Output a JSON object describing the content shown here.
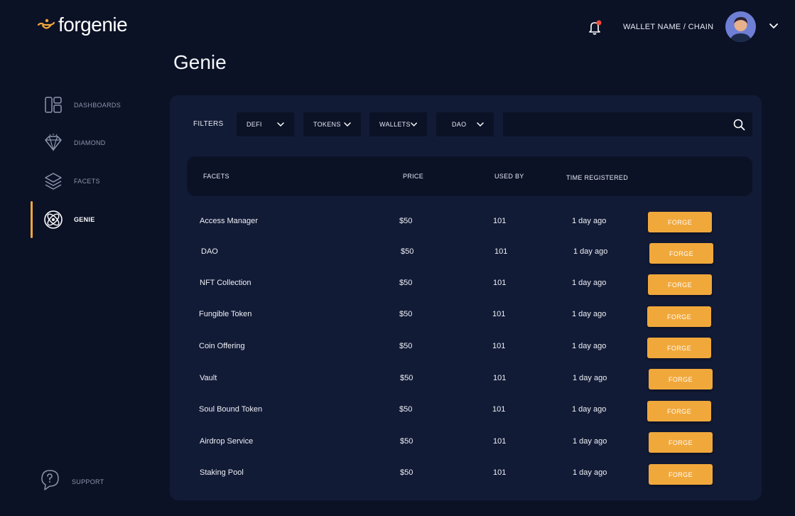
{
  "app": {
    "logo_text": "forgenie"
  },
  "header": {
    "wallet_label": "WALLET NAME / CHAIN"
  },
  "page": {
    "title": "Genie"
  },
  "sidebar": {
    "items": [
      {
        "label": "DASHBOARDS",
        "icon": "dashboard-icon"
      },
      {
        "label": "DIAMOND",
        "icon": "diamond-icon"
      },
      {
        "label": "FACETS",
        "icon": "layers-icon"
      },
      {
        "label": "GENIE",
        "icon": "genie-icon",
        "active": true
      }
    ],
    "support_label": "SUPPORT"
  },
  "filters": {
    "label": "FILTERS",
    "dropdowns": [
      "DEFI",
      "TOKENS",
      "WALLETS",
      "DAO"
    ],
    "search_placeholder": ""
  },
  "table": {
    "columns": [
      "FACETS",
      "PRICE",
      "USED BY",
      "TIME REGISTERED"
    ],
    "action_label": "FORGE",
    "rows": [
      {
        "name": "Access Manager",
        "price": "$50",
        "used_by": "101",
        "time": "1 day ago"
      },
      {
        "name": "DAO",
        "price": "$50",
        "used_by": "101",
        "time": "1 day ago"
      },
      {
        "name": "NFT Collection",
        "price": "$50",
        "used_by": "101",
        "time": "1 day ago"
      },
      {
        "name": "Fungible Token",
        "price": "$50",
        "used_by": "101",
        "time": "1 day ago"
      },
      {
        "name": "Coin Offering",
        "price": "$50",
        "used_by": "101",
        "time": "1 day ago"
      },
      {
        "name": "Vault",
        "price": "$50",
        "used_by": "101",
        "time": "1 day ago"
      },
      {
        "name": "Soul Bound Token",
        "price": "$50",
        "used_by": "101",
        "time": "1 day ago"
      },
      {
        "name": "Airdrop Service",
        "price": "$50",
        "used_by": "101",
        "time": "1 day ago"
      },
      {
        "name": "Staking Pool",
        "price": "$50",
        "used_by": "101",
        "time": "1 day ago"
      }
    ]
  },
  "colors": {
    "background": "#0b1226",
    "panel": "#121b36",
    "accent": "#f1a83b",
    "notification": "#f04a3a"
  }
}
